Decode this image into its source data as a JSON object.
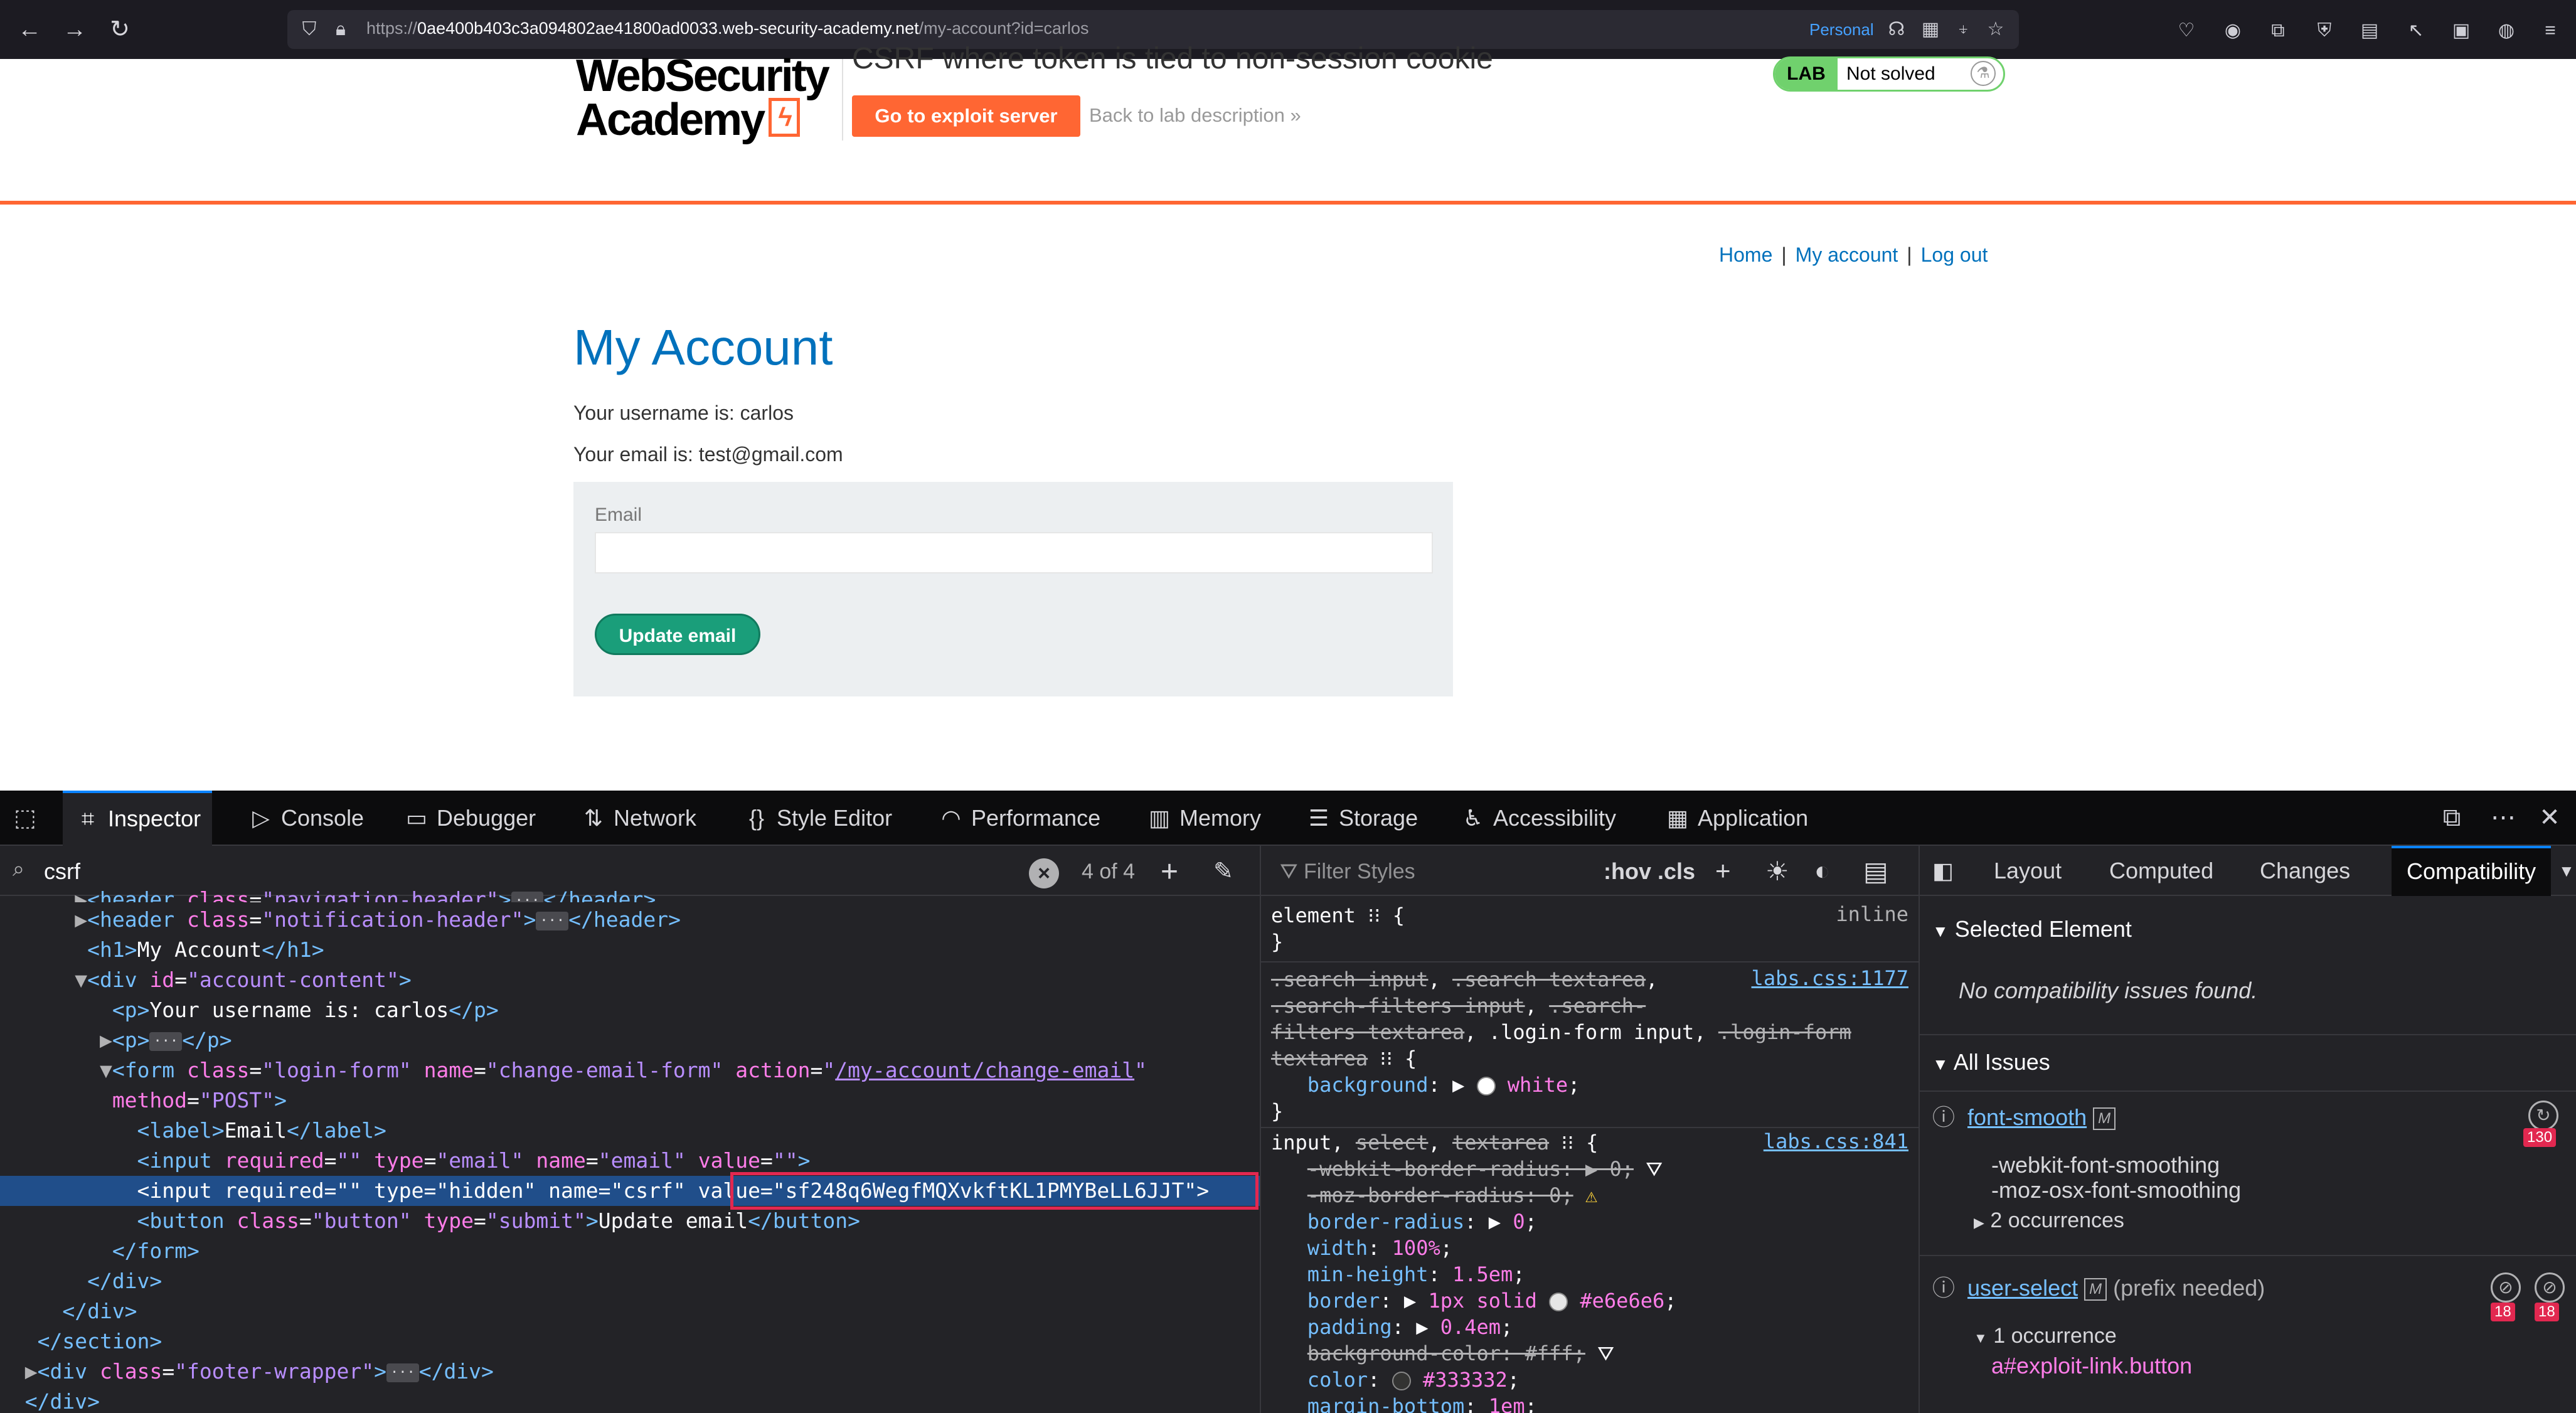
{
  "browser": {
    "url_prefix": "https://",
    "url_host": "0ae400b403c3a094802ae41800ad0033.web-security-academy.net",
    "url_path": "/my-account?id=carlos",
    "container_label": "Personal"
  },
  "lab": {
    "logo_line1": "WebSecurity",
    "logo_line2": "Academy",
    "title": "CSRF where token is tied to non-session cookie",
    "exploit_button": "Go to exploit server",
    "back_link": "Back to lab description",
    "status_badge": "LAB",
    "status_text": "Not solved"
  },
  "nav": {
    "home": "Home",
    "my_account": "My account",
    "log_out": "Log out"
  },
  "account": {
    "heading": "My Account",
    "username_line": "Your username is: carlos",
    "email_line": "Your email is: test@gmail.com",
    "email_label": "Email",
    "update_button": "Update email"
  },
  "devtools": {
    "tabs": [
      "Inspector",
      "Console",
      "Debugger",
      "Network",
      "Style Editor",
      "Performance",
      "Memory",
      "Storage",
      "Accessibility",
      "Application"
    ],
    "search_value": "csrf",
    "search_count": "4 of 4",
    "filter_placeholder": "Filter Styles",
    "hov": ":hov .cls",
    "sidebar_tabs": [
      "Layout",
      "Computed",
      "Changes",
      "Compatibility"
    ],
    "compat": {
      "selected_heading": "Selected Element",
      "no_issues": "No compatibility issues found.",
      "all_issues": "All Issues",
      "issue1_name": "font-smooth",
      "issue1_alt1": "-webkit-font-smoothing",
      "issue1_alt2": "-moz-osx-font-smoothing",
      "issue1_occ": "2 occurrences",
      "issue1_count": "130",
      "issue2_name": "user-select",
      "issue2_note": "(prefix needed)",
      "issue2_occ": "1 occurrence",
      "issue2_selector": "a#exploit-link.button",
      "issue2_count_a": "18",
      "issue2_count_b": "18"
    },
    "rules": {
      "element_sel": "element",
      "element_src": "inline",
      "r1_src": "labs.css:1177",
      "r2_src": "labs.css:841"
    }
  }
}
